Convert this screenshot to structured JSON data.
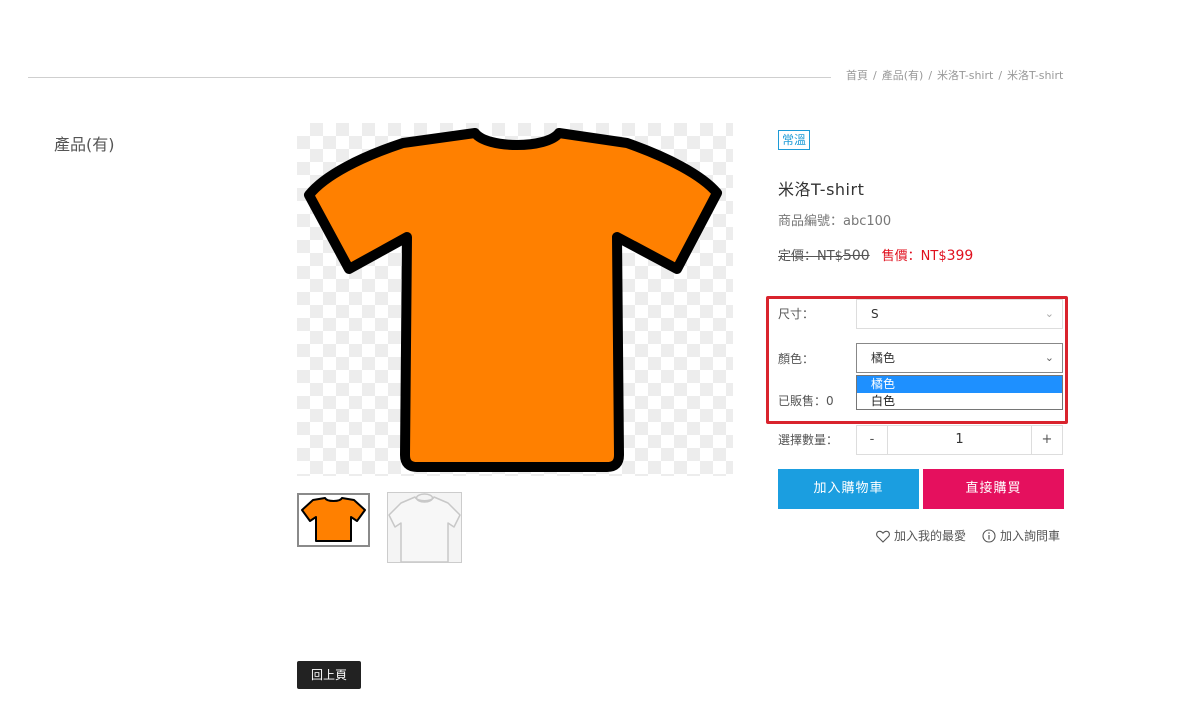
{
  "breadcrumb": {
    "items": [
      "首頁",
      "產品(有)",
      "米洛T-shirt",
      "米洛T-shirt"
    ],
    "separator": "/"
  },
  "sidebar": {
    "title": "產品(有)"
  },
  "product": {
    "badge": "常溫",
    "name": "米洛T-shirt",
    "code_label": "商品編號：abc100",
    "list_price_label": "定價：NT$",
    "list_price_value": "500",
    "sale_price_label": "售價：NT$",
    "sale_price_value": "399",
    "main_image_color": "#ff8000",
    "thumbnails": [
      "orange t-shirt",
      "white t-shirt"
    ]
  },
  "options": {
    "size_label": "尺寸：",
    "size_value": "S",
    "color_label": "顏色：",
    "color_value": "橘色",
    "color_options": [
      "橘色",
      "白色"
    ],
    "sold_label": "已販售：0",
    "qty_label": "選擇數量：",
    "qty_minus": "-",
    "qty_value": "1",
    "qty_plus": "+"
  },
  "actions": {
    "add_to_cart": "加入購物車",
    "buy_now": "直接購買",
    "favorite": "加入我的最愛",
    "inquiry": "加入詢問車"
  },
  "footer": {
    "back": "回上頁"
  },
  "colors": {
    "accent_blue": "#1b9ee0",
    "accent_pink": "#e5105e",
    "sale_red": "#e0101e",
    "highlight_red": "#d9232d",
    "dropdown_active": "#1e90ff"
  }
}
